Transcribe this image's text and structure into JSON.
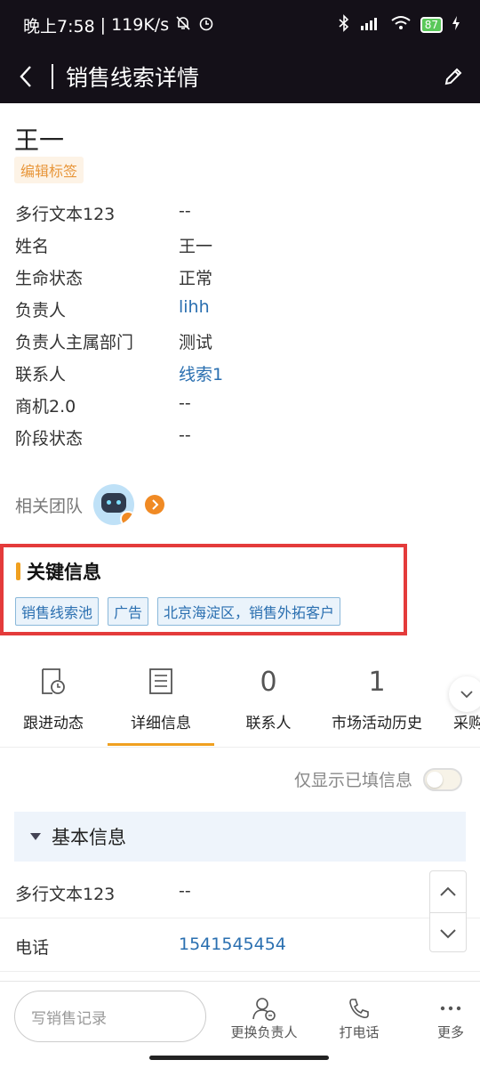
{
  "status_bar": {
    "time": "晚上7:58",
    "speed": "119K/s",
    "battery": "87"
  },
  "nav": {
    "title": "销售线索详情"
  },
  "record": {
    "name": "王一",
    "edit_tags": "编辑标签",
    "fields": [
      {
        "label": "多行文本123",
        "value": "--",
        "link": false
      },
      {
        "label": "姓名",
        "value": "王一",
        "link": false
      },
      {
        "label": "生命状态",
        "value": "正常",
        "link": false
      },
      {
        "label": "负责人",
        "value": "lihh",
        "link": true
      },
      {
        "label": "负责人主属部门",
        "value": "测试",
        "link": false
      },
      {
        "label": "联系人",
        "value": "线索1",
        "link": true
      },
      {
        "label": "商机2.0",
        "value": "--",
        "link": false
      },
      {
        "label": "阶段状态",
        "value": "--",
        "link": false
      }
    ],
    "team_label": "相关团队"
  },
  "key_info": {
    "title": "关键信息",
    "chips": [
      "销售线索池",
      "广告",
      "北京海淀区，销售外拓客户"
    ]
  },
  "tabs": [
    {
      "label": "跟进动态",
      "icon": "clock-doc-icon",
      "count": ""
    },
    {
      "label": "详细信息",
      "icon": "list-doc-icon",
      "count": ""
    },
    {
      "label": "联系人",
      "icon": "",
      "count": "0"
    },
    {
      "label": "市场活动历史",
      "icon": "",
      "count": "1"
    },
    {
      "label": "采购",
      "icon": "",
      "count": ""
    }
  ],
  "filter": {
    "label": "仅显示已填信息",
    "enabled": false
  },
  "basic": {
    "title": "基本信息",
    "rows": [
      {
        "label": "多行文本123",
        "value": "--",
        "link": false
      },
      {
        "label": "电话",
        "value": "1541545454",
        "link": true
      }
    ]
  },
  "bottom": {
    "compose_placeholder": "写销售记录",
    "change_owner": "更换负责人",
    "call": "打电话",
    "more": "更多"
  },
  "colors": {
    "accent": "#f0a020",
    "link": "#2a6fb0",
    "highlight_border": "#e43b3b",
    "header_bg": "#141018"
  }
}
